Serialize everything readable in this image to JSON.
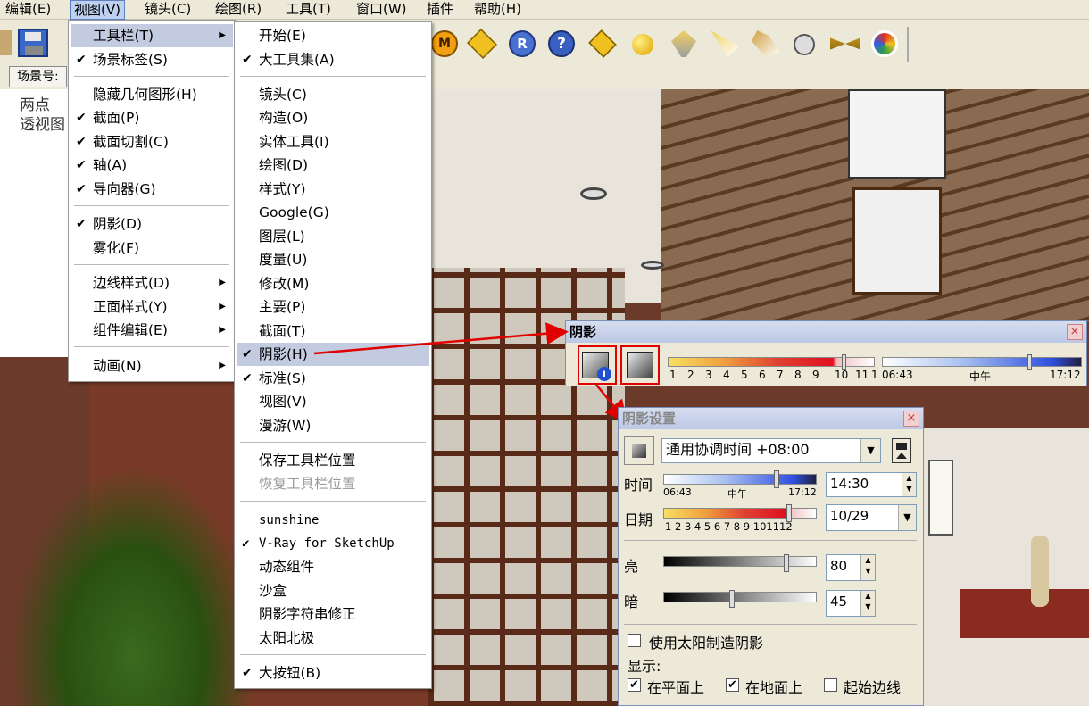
{
  "menubar": {
    "items": [
      {
        "label": "编辑(E)"
      },
      {
        "label": "视图(V)"
      },
      {
        "label": "镜头(C)"
      },
      {
        "label": "绘图(R)"
      },
      {
        "label": "工具(T)"
      },
      {
        "label": "窗口(W)"
      },
      {
        "label": "插件"
      },
      {
        "label": "帮助(H)"
      }
    ]
  },
  "scene_tab": {
    "label": "场景号:"
  },
  "viewport": {
    "label_line1": "两点",
    "label_line2": "透视图"
  },
  "view_menu": {
    "items": [
      {
        "label": "工具栏(T)",
        "checked": "",
        "submenu": "▶"
      },
      {
        "label": "场景标签(S)",
        "checked": "✔",
        "submenu": ""
      },
      {
        "label": "隐藏几何图形(H)",
        "checked": "",
        "submenu": ""
      },
      {
        "label": "截面(P)",
        "checked": "✔",
        "submenu": ""
      },
      {
        "label": "截面切割(C)",
        "checked": "✔",
        "submenu": ""
      },
      {
        "label": "轴(A)",
        "checked": "✔",
        "submenu": ""
      },
      {
        "label": "导向器(G)",
        "checked": "✔",
        "submenu": ""
      },
      {
        "label": "阴影(D)",
        "checked": "✔",
        "submenu": ""
      },
      {
        "label": "雾化(F)",
        "checked": "",
        "submenu": ""
      },
      {
        "label": "边线样式(D)",
        "checked": "",
        "submenu": "▶"
      },
      {
        "label": "正面样式(Y)",
        "checked": "",
        "submenu": "▶"
      },
      {
        "label": "组件编辑(E)",
        "checked": "",
        "submenu": "▶"
      },
      {
        "label": "动画(N)",
        "checked": "",
        "submenu": "▶"
      }
    ]
  },
  "toolbar_menu": {
    "items": [
      {
        "label": "开始(E)",
        "checked": ""
      },
      {
        "label": "大工具集(A)",
        "checked": "✔"
      },
      {
        "label": "镜头(C)",
        "checked": ""
      },
      {
        "label": "构造(O)",
        "checked": ""
      },
      {
        "label": "实体工具(I)",
        "checked": ""
      },
      {
        "label": "绘图(D)",
        "checked": ""
      },
      {
        "label": "样式(Y)",
        "checked": ""
      },
      {
        "label": "Google(G)",
        "checked": ""
      },
      {
        "label": "图层(L)",
        "checked": ""
      },
      {
        "label": "度量(U)",
        "checked": ""
      },
      {
        "label": "修改(M)",
        "checked": ""
      },
      {
        "label": "主要(P)",
        "checked": ""
      },
      {
        "label": "截面(T)",
        "checked": ""
      },
      {
        "label": "阴影(H)",
        "checked": "✔"
      },
      {
        "label": "标准(S)",
        "checked": "✔"
      },
      {
        "label": "视图(V)",
        "checked": ""
      },
      {
        "label": "漫游(W)",
        "checked": ""
      },
      {
        "label": "保存工具栏位置",
        "checked": ""
      },
      {
        "label": "恢复工具栏位置",
        "checked": ""
      },
      {
        "label": "sunshine",
        "checked": ""
      },
      {
        "label": "V-Ray for SketchUp",
        "checked": "✔"
      },
      {
        "label": "动态组件",
        "checked": ""
      },
      {
        "label": "沙盒",
        "checked": ""
      },
      {
        "label": "阴影字符串修正",
        "checked": ""
      },
      {
        "label": "太阳北极",
        "checked": ""
      },
      {
        "label": "大按钮(B)",
        "checked": "✔"
      }
    ]
  },
  "shadow_toolbar": {
    "title": "阴影",
    "close": "×",
    "month_ticks": [
      "1",
      "2",
      "3",
      "4",
      "5",
      "6",
      "7",
      "8",
      "9",
      "10",
      "11",
      "1"
    ],
    "time_start": "06:43",
    "time_mid": "中午",
    "time_end": "17:12"
  },
  "shadow_dialog": {
    "title": "阴影设置",
    "close": "×",
    "timezone": "通用协调时间 +08:00",
    "time_label": "时间",
    "time_start": "06:43",
    "time_mid": "中午",
    "time_end": "17:12",
    "time_value": "14:30",
    "date_label": "日期",
    "date_ticks": "1 2 3 4 5 6 7 8 9 101112",
    "date_value": "10/29",
    "light_label": "亮",
    "light_value": "80",
    "light_level": 0.8,
    "dark_label": "暗",
    "dark_value": "45",
    "dark_level": 0.45,
    "use_sun_label": "使用太阳制造阴影",
    "display_label": "显示:",
    "on_faces_label": "在平面上",
    "on_ground_label": "在地面上",
    "from_edges_label": "起始边线",
    "check_mark": "✔"
  },
  "colors": {
    "menu_highlight": "#c2cbe0",
    "annotation_red": "#e00000",
    "window_title": "#bcc8e6"
  }
}
